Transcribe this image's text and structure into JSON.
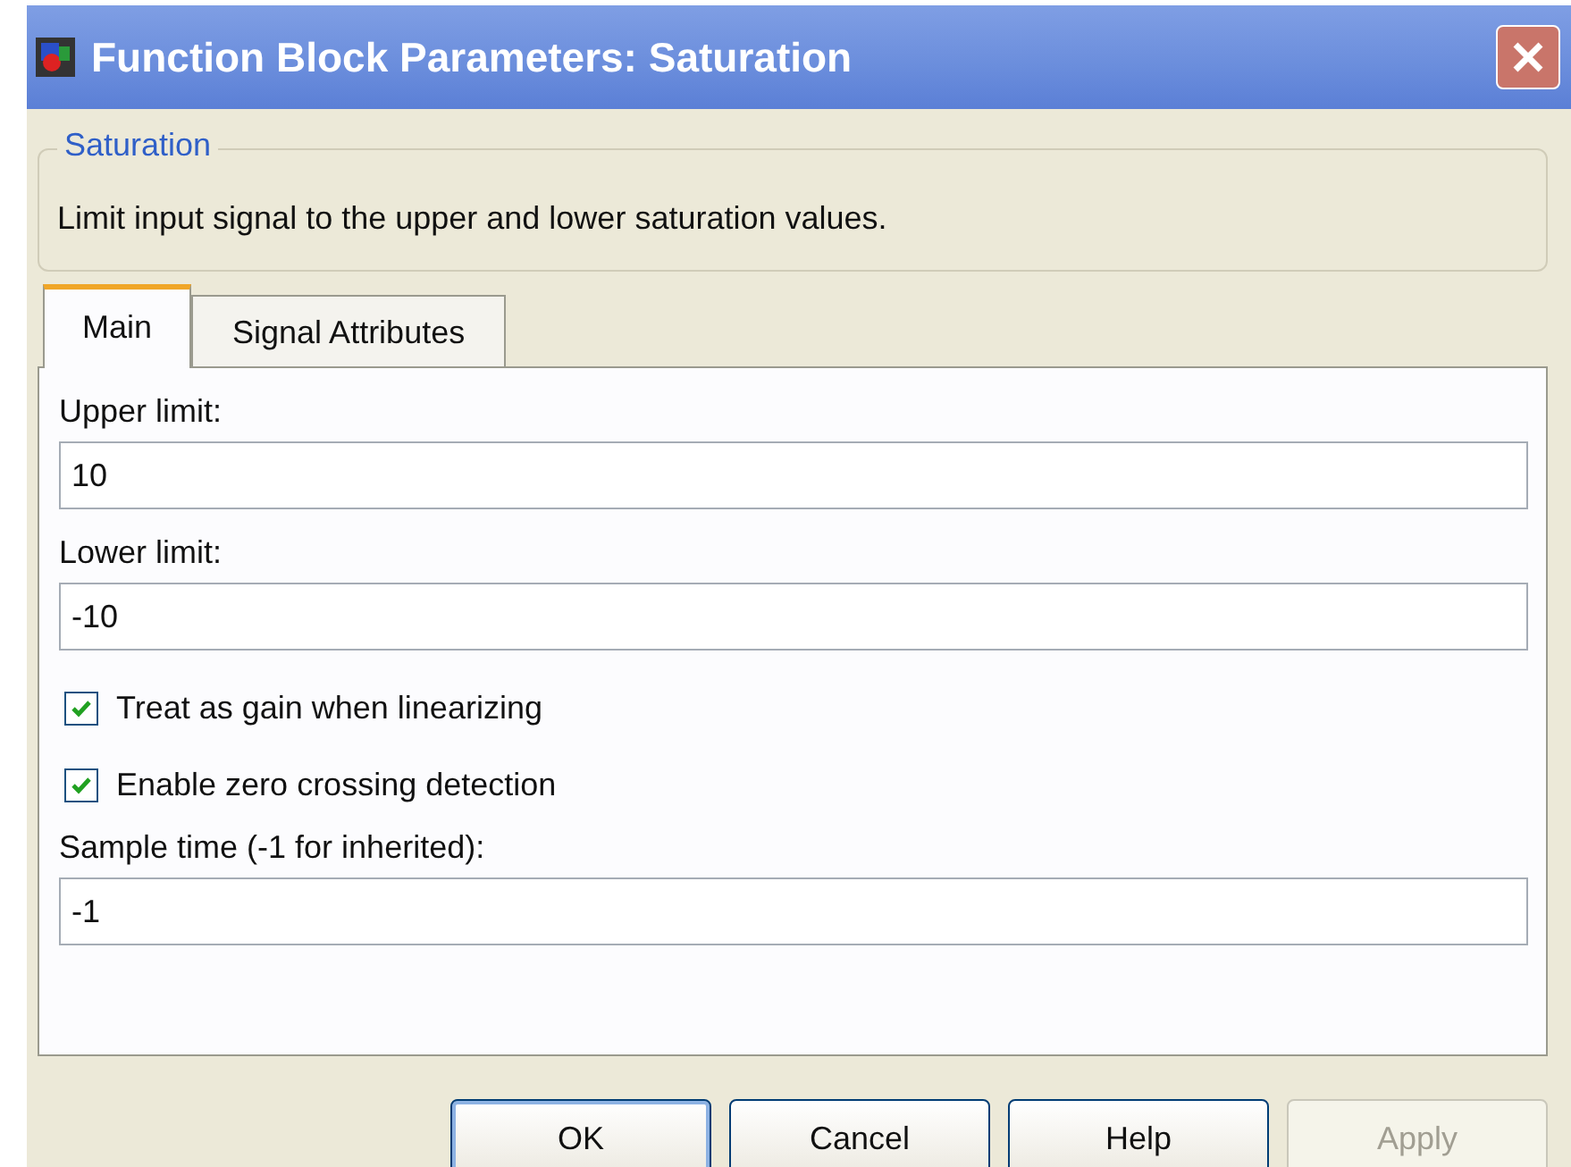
{
  "window": {
    "title": "Function Block Parameters: Saturation"
  },
  "group": {
    "title": "Saturation",
    "description": "Limit input signal to the upper and lower saturation values."
  },
  "tabs": [
    {
      "label": "Main",
      "selected": true
    },
    {
      "label": "Signal Attributes",
      "selected": false
    }
  ],
  "parameters": [
    {
      "kind": "text",
      "label": "Upper limit:",
      "value": "10"
    },
    {
      "kind": "text",
      "label": "Lower limit:",
      "value": "-10"
    },
    {
      "kind": "checkbox",
      "label": "Treat as gain when linearizing",
      "checked": true
    },
    {
      "kind": "checkbox",
      "label": "Enable zero crossing detection",
      "checked": true
    },
    {
      "kind": "text",
      "label": "Sample time (-1 for inherited):",
      "value": "-1"
    }
  ],
  "buttons": [
    {
      "label": "OK",
      "disabled": false,
      "default": true
    },
    {
      "label": "Cancel",
      "disabled": false,
      "default": false
    },
    {
      "label": "Help",
      "disabled": false,
      "default": false
    },
    {
      "label": "Apply",
      "disabled": true,
      "default": false
    }
  ]
}
